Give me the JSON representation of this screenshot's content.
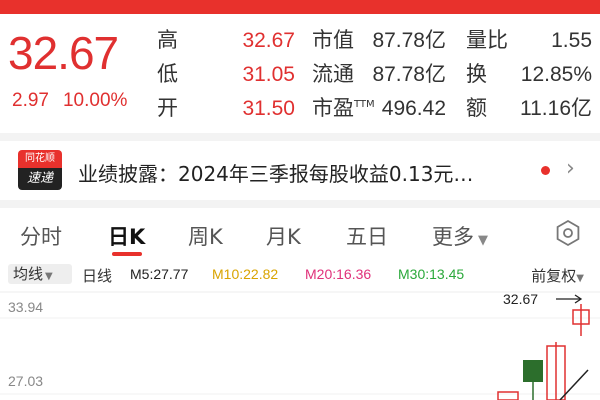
{
  "quote": {
    "price": "32.67",
    "change": "2.97",
    "change_pct": "10.00%",
    "rows": [
      {
        "label": "高",
        "value": "32.67",
        "dlabel": "市值",
        "dvalue": "87.78亿",
        "xlabel": "量比",
        "xvalue": "1.55"
      },
      {
        "label": "低",
        "value": "31.05",
        "dlabel": "流通",
        "dvalue": "87.78亿",
        "xlabel": "换",
        "xvalue": "12.85%"
      },
      {
        "label": "开",
        "value": "31.50",
        "dlabel": "市盈",
        "dlabel_sup": "TTM",
        "dvalue": "496.42",
        "xlabel": "额",
        "xvalue": "11.16亿"
      }
    ]
  },
  "news": {
    "logo_top": "同花顺",
    "logo_bottom": "速递",
    "text": "业绩披露：2024年三季报每股收益0.13元…"
  },
  "tabs": [
    {
      "label": "分时"
    },
    {
      "label": "日K"
    },
    {
      "label": "周K"
    },
    {
      "label": "月K"
    },
    {
      "label": "五日"
    },
    {
      "label": "更多"
    }
  ],
  "ma_bar": {
    "toggle": "均线",
    "period": "日线",
    "items": [
      {
        "text": "M5:27.77",
        "color": "#222222"
      },
      {
        "text": "M10:22.82",
        "color": "#d9a400"
      },
      {
        "text": "M20:16.36",
        "color": "#e0307a"
      },
      {
        "text": "M30:13.45",
        "color": "#2aa83a"
      }
    ],
    "adjust": "前复权"
  },
  "chart": {
    "y_labels": [
      "33.94",
      "27.03"
    ],
    "latest_price": "32.67",
    "colors": {
      "up": "#e03030",
      "down": "#2c6e2c"
    }
  }
}
